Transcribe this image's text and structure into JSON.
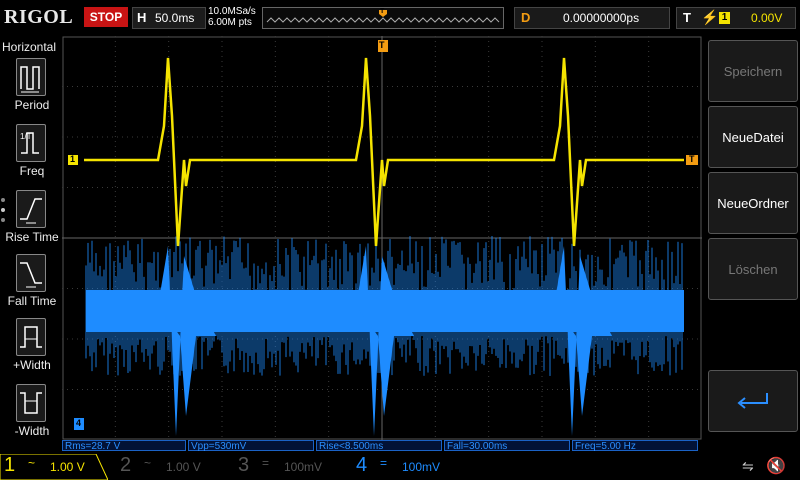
{
  "header": {
    "brand": "RIGOL",
    "run_state": "STOP",
    "timebase_label": "H",
    "timebase_value": "50.0ms",
    "sample_rate": "10.0MSa/s",
    "memory_depth": "6.00M pts",
    "delay_label": "D",
    "delay_value": "0.00000000ps",
    "trigger_label": "T",
    "trigger_source": "1",
    "trigger_level": "0.00V",
    "trigger_marker": "T"
  },
  "left_menu": {
    "title": "Horizontal",
    "items": [
      {
        "label": "Period",
        "icon": "period-icon"
      },
      {
        "label": "Freq",
        "icon": "frequency-icon"
      },
      {
        "label": "Rise Time",
        "icon": "rise-time-icon"
      },
      {
        "label": "Fall Time",
        "icon": "fall-time-icon"
      },
      {
        "label": "+Width",
        "icon": "positive-width-icon"
      },
      {
        "label": "-Width",
        "icon": "negative-width-icon"
      }
    ]
  },
  "right_menu": {
    "title": "Speichern",
    "buttons": [
      {
        "label": "Speichern",
        "enabled": false
      },
      {
        "label": "NeueDatei",
        "enabled": true
      },
      {
        "label": "NeueOrdner",
        "enabled": true
      },
      {
        "label": "Löschen",
        "enabled": false
      }
    ],
    "back_icon": "return-arrow-icon"
  },
  "measurements": [
    {
      "text": "Rms=28.7 V"
    },
    {
      "text": "Vpp=530mV"
    },
    {
      "text": "Rise<8.500ms"
    },
    {
      "text": "Fall=30.00ms"
    },
    {
      "text": "Freq=5.00 Hz"
    }
  ],
  "channels": [
    {
      "num": "1",
      "coupling": "~",
      "scale": "1.00 V",
      "color": "#f5e400",
      "active": true
    },
    {
      "num": "2",
      "coupling": "~",
      "scale": "1.00 V",
      "color": "#00b4c8",
      "active": false
    },
    {
      "num": "3",
      "coupling": "=",
      "scale": "100mV",
      "color": "#c83cc8",
      "active": false
    },
    {
      "num": "4",
      "coupling": "=",
      "scale": "100mV",
      "color": "#1e8cff",
      "active": true
    }
  ],
  "waveform_markers": {
    "ch1_marker": "1",
    "ch4_marker": "4",
    "trigger_level_marker": "T"
  },
  "colors": {
    "ch1": "#f5e400",
    "ch4": "#1e8cff",
    "stop": "#c81414",
    "delay": "#f39c12"
  }
}
